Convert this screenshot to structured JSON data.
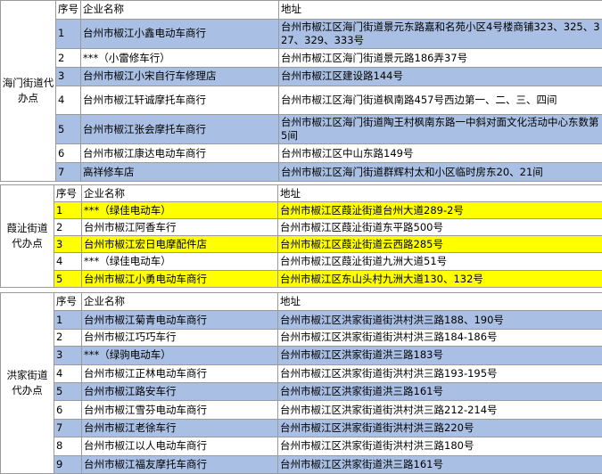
{
  "section1": {
    "group_label": "海门街道代办点",
    "headers": {
      "seq": "序号",
      "name": "企业名称",
      "addr": "地址"
    },
    "rows": [
      {
        "seq": "1",
        "name": "台州市椒江小鑫电动车商行",
        "addr": "台州市椒江区海门街道景元东路嘉和名苑小区4号楼商铺323、325、327、329、333号",
        "color": "blue"
      },
      {
        "seq": "2",
        "name": "***（小雷修车行）",
        "addr": "台州市椒江区海门街道景元路186弄37号",
        "color": "white"
      },
      {
        "seq": "3",
        "name": "台州市椒江小宋自行车修理店",
        "addr": "台州市椒江区建设路144号",
        "color": "blue"
      },
      {
        "seq": "4",
        "name": "台州市椒江轩诚摩托车商行",
        "addr": "台州市椒江区海门街道枫南路457号西边第一、二、三、四间",
        "color": "white"
      },
      {
        "seq": "5",
        "name": "台州市椒江张会摩托车商行",
        "addr": "台州市椒江区海门街道陶王村枫南东路一中斜对面文化活动中心东数第5间",
        "color": "blue"
      },
      {
        "seq": "6",
        "name": "台州市椒江康达电动车商行",
        "addr": "台州市椒江区中山东路149号",
        "color": "white"
      },
      {
        "seq": "7",
        "name": "高祥修车店",
        "addr": "台州市椒江区海门街道群辉村太和小区临时房东20、21间",
        "color": "blue"
      }
    ]
  },
  "section2": {
    "group_label": "葭沚街道代办点",
    "headers": {
      "seq": "序号",
      "name": "企业名称",
      "addr": "地址"
    },
    "rows": [
      {
        "seq": "1",
        "name": "***（绿佳电动车）",
        "addr": "台州市椒江区葭沚街道台州大道289-2号",
        "color": "yellow"
      },
      {
        "seq": "2",
        "name": "台州市椒江阿香车行",
        "addr": "台州市椒江区葭沚街道东平路500号",
        "color": "white"
      },
      {
        "seq": "3",
        "name": "台州市椒江宏日电摩配件店",
        "addr": "台州市椒江区葭沚街道云西路285号",
        "color": "yellow"
      },
      {
        "seq": "4",
        "name": "***（绿佳电动车）",
        "addr": "台州市椒江区葭沚街道九洲大道51号",
        "color": "white"
      },
      {
        "seq": "5",
        "name": "台州市椒江小勇电动车商行",
        "addr": "台州市椒江区东山头村九洲大道130、132号",
        "color": "yellow"
      }
    ]
  },
  "section3": {
    "group_label": "洪家街道代办点",
    "headers": {
      "seq": "序号",
      "name": "企业名称",
      "addr": "地址"
    },
    "rows": [
      {
        "seq": "1",
        "name": "台州市椒江菊青电动车商行",
        "addr": "台州市椒江区洪家街道街洪村洪三路188、190号",
        "color": "blue"
      },
      {
        "seq": "2",
        "name": "台州市椒江巧巧车行",
        "addr": "台州市椒江区洪家街道街洪村洪三路184-186号",
        "color": "white"
      },
      {
        "seq": "3",
        "name": "***（绿驹电动车）",
        "addr": "台州市椒江区洪家街道洪三路183号",
        "color": "blue"
      },
      {
        "seq": "4",
        "name": "台州市椒江正林电动车商行",
        "addr": "台州市椒江区洪家街道街洪村洪三路193-195号",
        "color": "white"
      },
      {
        "seq": "5",
        "name": "台州市椒江路安车行",
        "addr": "台州市椒江区洪家街道洪三路161号",
        "color": "blue"
      },
      {
        "seq": "6",
        "name": "台州市椒江雪芬电动车商行",
        "addr": "台州市椒江区洪家街道街洪村洪三路212-214号",
        "color": "white"
      },
      {
        "seq": "7",
        "name": "台州市椒江老徐车行",
        "addr": "台州市椒江区洪家街道街洪村洪三路220号",
        "color": "blue"
      },
      {
        "seq": "8",
        "name": "台州市椒江以人电动车商行",
        "addr": "台州市椒江区洪家街道街洪村洪三路180号",
        "color": "white"
      },
      {
        "seq": "9",
        "name": "台州市椒江福友摩托车商行",
        "addr": "台州市椒江区洪家街道洪三路161号",
        "color": "blue"
      }
    ]
  },
  "colors": {
    "blue": "#a9bfe3",
    "yellow": "#ffff00",
    "white": "#ffffff",
    "border": "#9a9a9a"
  }
}
